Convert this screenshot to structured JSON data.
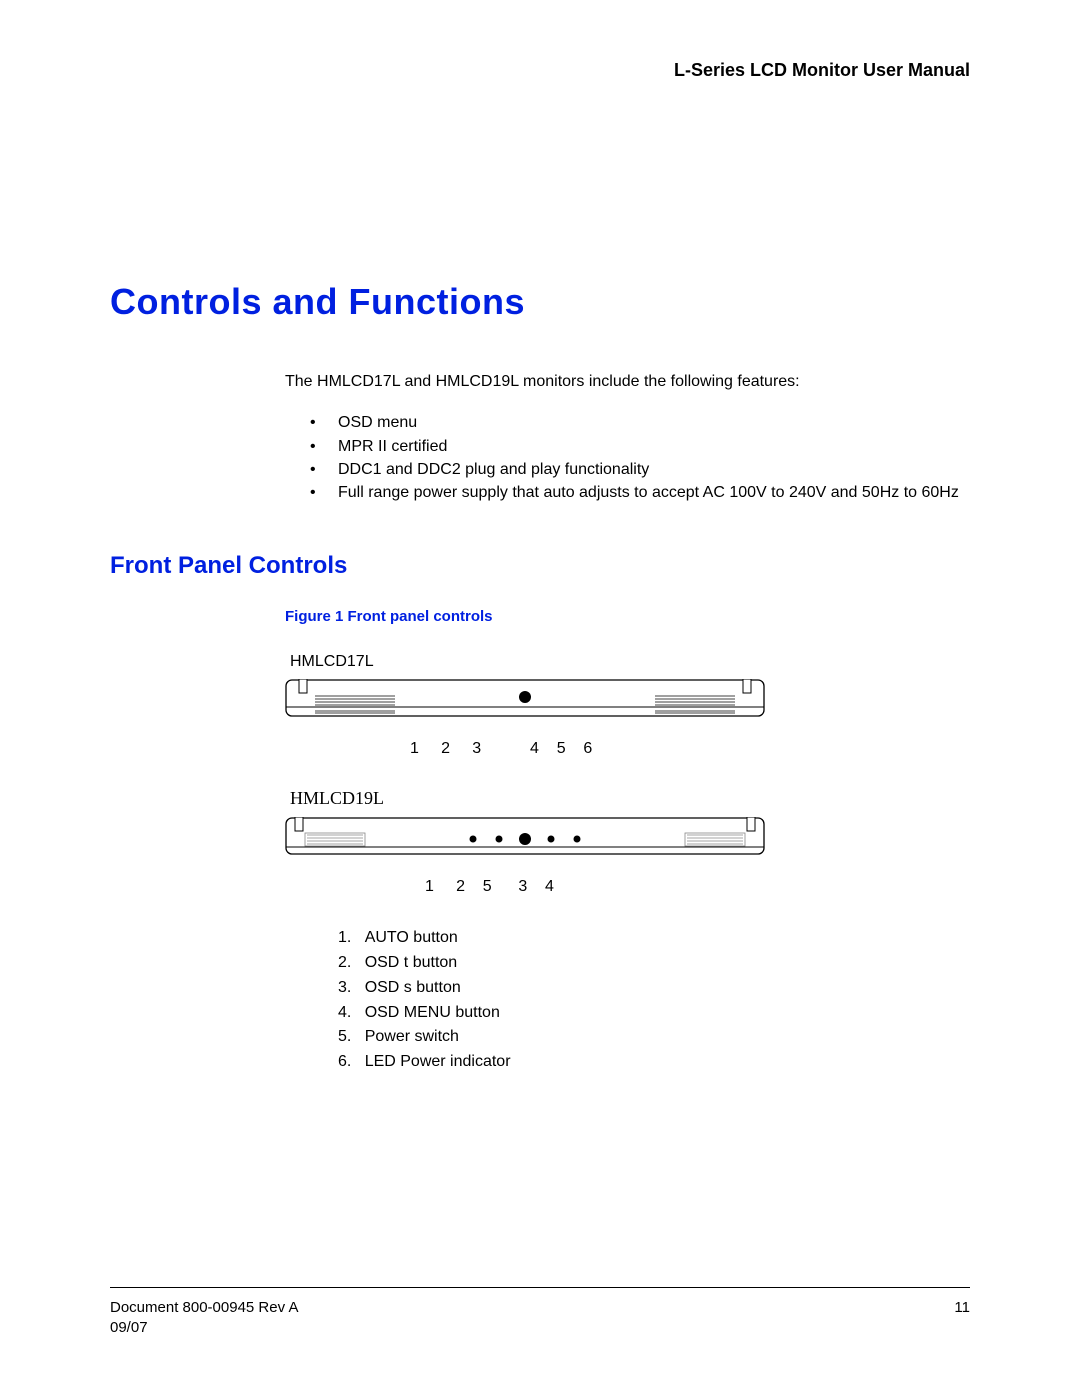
{
  "header": {
    "title": "L-Series LCD Monitor User Manual"
  },
  "heading_main": "Controls and Functions",
  "intro": "The HMLCD17L and HMLCD19L monitors include the following features:",
  "features": [
    "OSD menu",
    "MPR II certified",
    "DDC1 and DDC2 plug and play functionality",
    "Full range power supply that auto adjusts to accept AC 100V to 240V and 50Hz to 60Hz"
  ],
  "heading_sub": "Front Panel Controls",
  "figure_caption": "Figure 1    Front panel controls",
  "model1_label": "HMLCD17L",
  "model1_numbers": "1     2     3           4    5    6",
  "model2_label": "HMLCD19L",
  "model2_numbers": "1     2    5      3    4",
  "controls_list": [
    "AUTO button",
    "OSD t button",
    "OSD s button",
    "OSD MENU button",
    "Power switch",
    "LED Power indicator"
  ],
  "footer": {
    "doc_line1": "Document 800-00945 Rev A",
    "doc_line2": "09/07",
    "page": "11"
  }
}
